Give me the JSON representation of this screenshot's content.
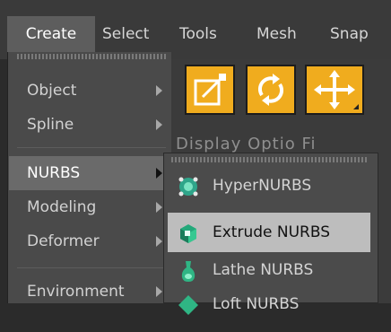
{
  "menubar": {
    "items": [
      "Create",
      "Select",
      "Tools",
      "Mesh",
      "Snap"
    ]
  },
  "create_menu": {
    "items": [
      {
        "label": "Object"
      },
      {
        "label": "Spline"
      },
      {
        "label": "NURBS"
      },
      {
        "label": "Modeling"
      },
      {
        "label": "Deformer"
      },
      {
        "label": "Environment"
      }
    ],
    "active": "NURBS"
  },
  "nurbs_submenu": {
    "items": [
      {
        "label": "HyperNURBS",
        "icon": "hypernurbs-icon"
      },
      {
        "label": "Extrude NURBS",
        "icon": "extrude-nurbs-icon"
      },
      {
        "label": "Lathe NURBS",
        "icon": "lathe-nurbs-icon"
      },
      {
        "label": "Loft NURBS",
        "icon": "loft-nurbs-icon"
      }
    ],
    "highlighted": "Extrude NURBS"
  },
  "toolbar": {
    "buttons": [
      "scale-tool",
      "rotate-tool",
      "move-tool"
    ],
    "accent": "#f0ac1e"
  },
  "background_peek": "Display Optio Fi"
}
